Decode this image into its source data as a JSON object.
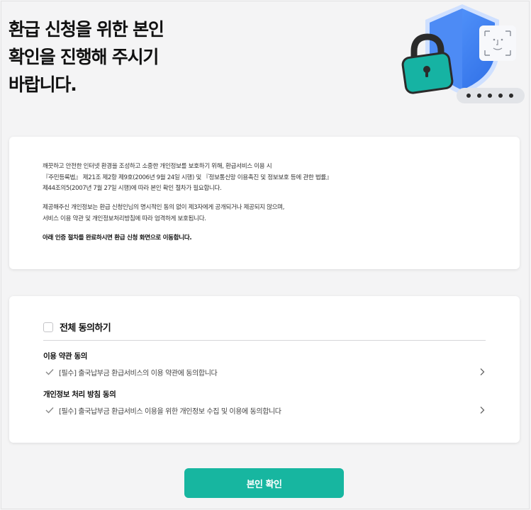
{
  "header": {
    "title_lines": [
      "환급 신청을 위한 본인",
      "확인을 진행해 주시기",
      "바랍니다."
    ]
  },
  "hero": {
    "icons": [
      "shield-icon",
      "padlock-icon",
      "face-id-icon",
      "password-dots-icon"
    ],
    "colors": {
      "shield": "#3a7ef0",
      "lock_body": "#16b3a3",
      "lock_shackle": "#2b2b2b"
    }
  },
  "notice": {
    "paragraph1": [
      "깨끗하고 안전한 인터넷 환경을 조성하고 소중한 개인정보를 보호하기 위해, 환급서비스 이용 시",
      "『주민등록법』 제21조 제2항 제9호(2006년 9월 24일 시행) 및 『정보통신망 이용촉진 및 정보보호 등에 관한 법률』",
      "제44조의5(2007년 7월 27일 시행)에 따라 본인 확인 절차가 필요합니다."
    ],
    "paragraph2": [
      "제공해주신 개인정보는 환급 신청인님의 명시적인 동의 없이 제3자에게 공개되거나 제공되지 않으며,",
      "서비스 이용 약관 및 개인정보처리방침에 따라 엄격하게 보호됩니다."
    ],
    "paragraph3": "아래 인증 절차를 완료하시면 환급 신청 화면으로 이동합니다."
  },
  "agreement": {
    "all_label": "전체 동의하기",
    "sections": [
      {
        "title": "이용 약관 동의",
        "item": "[필수] 출국납부금 환급서비스의 이용 약관에 동의합니다"
      },
      {
        "title": "개인정보 처리 방침 동의",
        "item": "[필수] 출국납부금 환급서비스 이용을 위한 개인정보 수집 및 이용에 동의합니다"
      }
    ]
  },
  "confirm_button": {
    "label": "본인 확인",
    "color": "#17b6a0"
  }
}
